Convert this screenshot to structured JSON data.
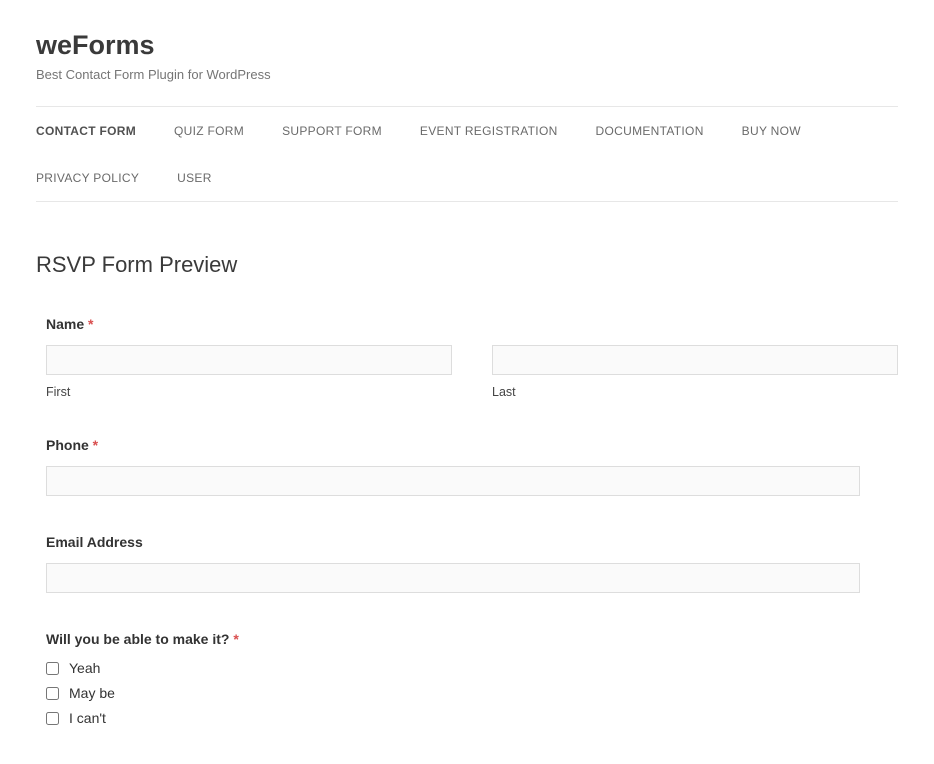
{
  "header": {
    "title": "weForms",
    "tagline": "Best Contact Form Plugin for WordPress"
  },
  "nav": {
    "items": [
      {
        "label": "CONTACT FORM",
        "active": true
      },
      {
        "label": "QUIZ FORM",
        "active": false
      },
      {
        "label": "SUPPORT FORM",
        "active": false
      },
      {
        "label": "EVENT REGISTRATION",
        "active": false
      },
      {
        "label": "DOCUMENTATION",
        "active": false
      },
      {
        "label": "BUY NOW",
        "active": false
      },
      {
        "label": "PRIVACY POLICY",
        "active": false
      },
      {
        "label": "USER",
        "active": false
      }
    ]
  },
  "page": {
    "title": "RSVP Form Preview"
  },
  "form": {
    "name": {
      "label": "Name",
      "required_mark": "*",
      "first_sub": "First",
      "last_sub": "Last",
      "first_value": "",
      "last_value": ""
    },
    "phone": {
      "label": "Phone",
      "required_mark": "*",
      "value": ""
    },
    "email": {
      "label": "Email Address",
      "value": ""
    },
    "attend": {
      "label": "Will you be able to make it?",
      "required_mark": "*",
      "options": [
        {
          "label": "Yeah"
        },
        {
          "label": "May be"
        },
        {
          "label": "I can't"
        }
      ]
    }
  }
}
